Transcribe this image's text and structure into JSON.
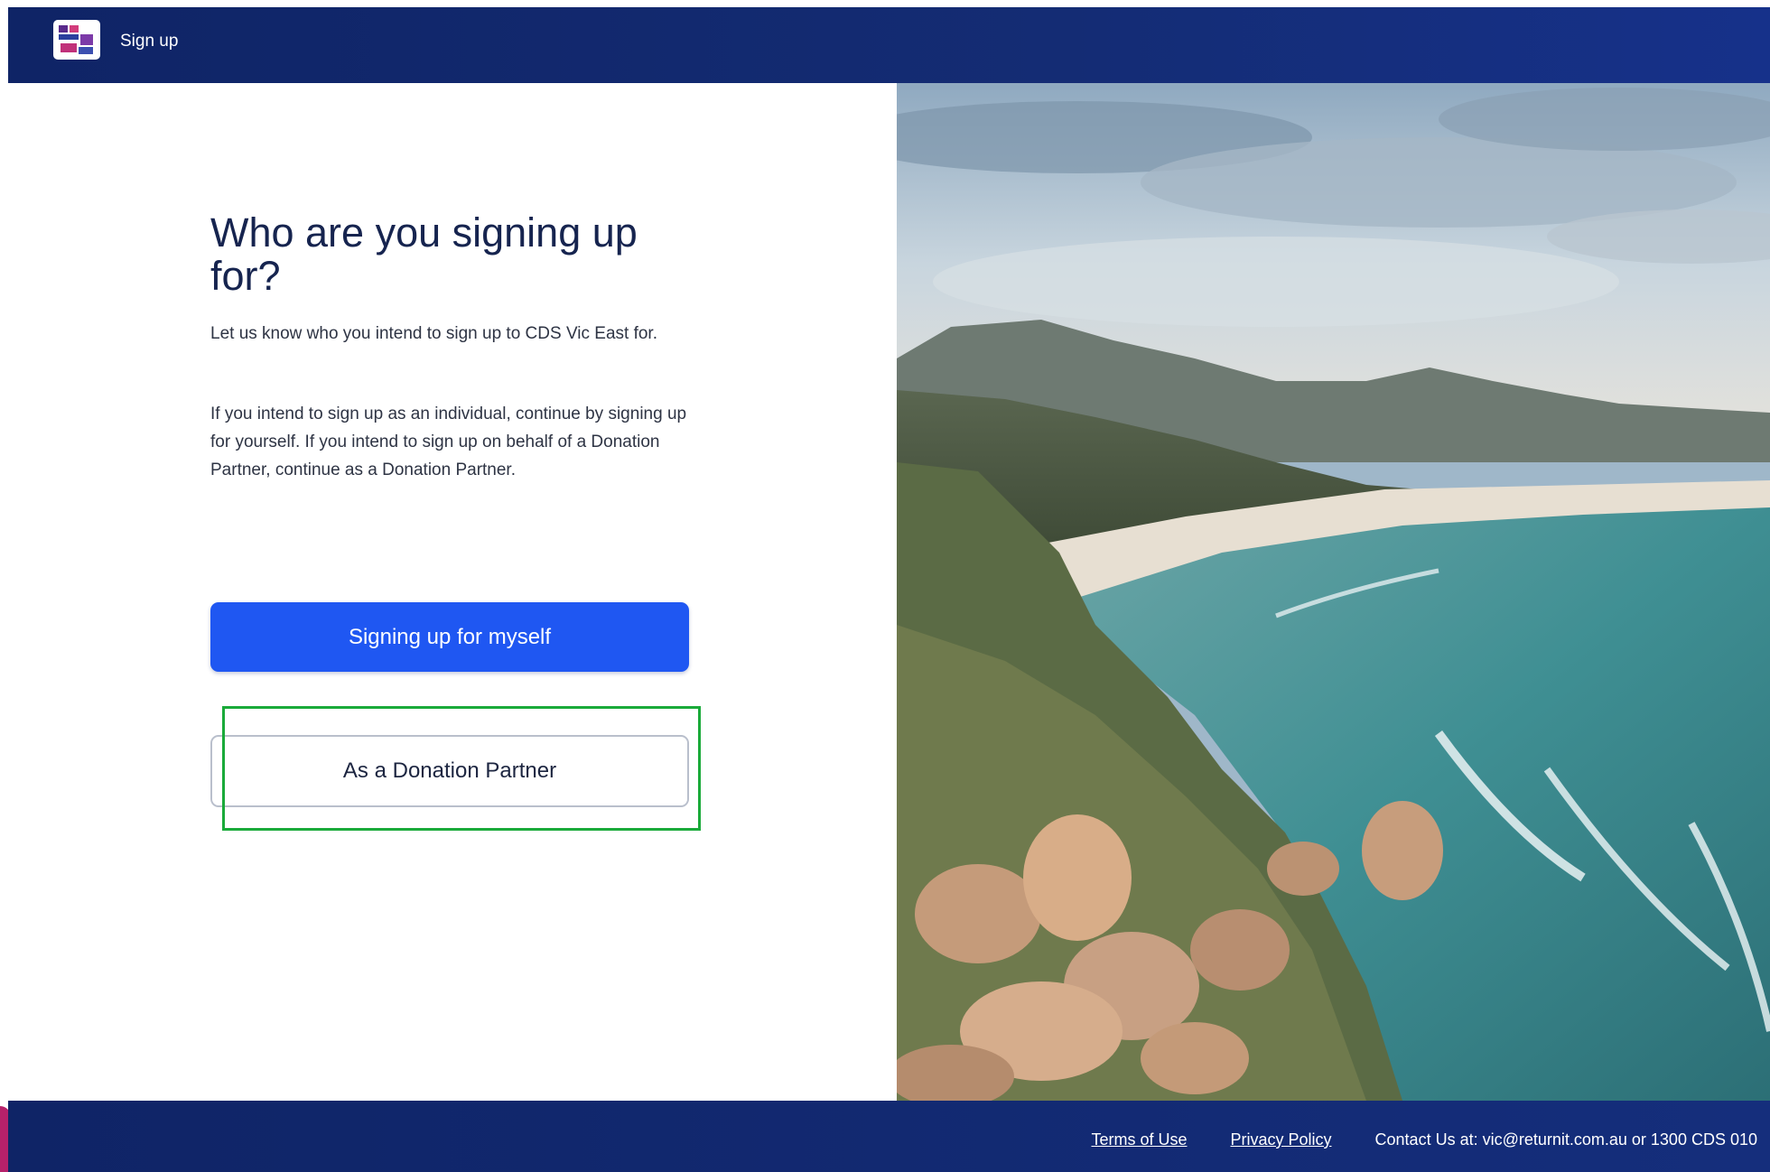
{
  "header": {
    "title": "Sign up"
  },
  "main": {
    "heading": "Who are you signing up for?",
    "intro": "Let us know who you intend to sign up to CDS Vic East for.",
    "instructions": "If you intend to sign up as an individual, continue by signing up for yourself. If you intend to sign up on behalf of a Donation Partner, continue as a Donation Partner.",
    "primary_button": "Signing up for myself",
    "secondary_button": "As a Donation Partner"
  },
  "footer": {
    "terms": "Terms of Use",
    "privacy": "Privacy Policy",
    "contact": "Contact Us at: vic@returnit.com.au or 1300 CDS 010"
  },
  "colors": {
    "brand_navy": "#142c74",
    "primary_button": "#1f57f2",
    "highlight": "#1aaa3a"
  }
}
